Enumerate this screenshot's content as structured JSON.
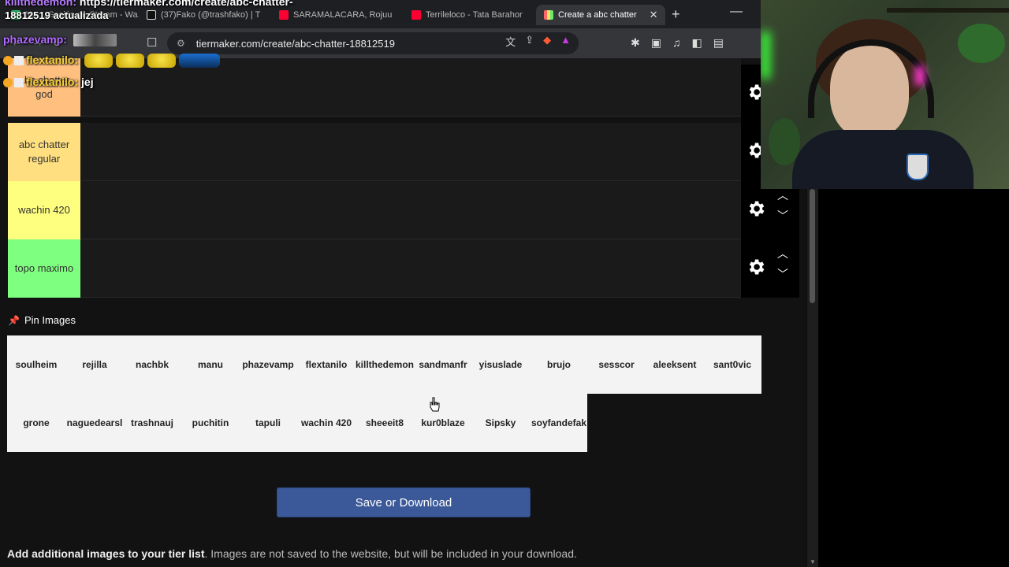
{
  "chat": [
    {
      "user": "killthedemon:",
      "text": "https://tiermaker.com/create/abc-chatter-",
      "cont": "18812519 actualizada"
    },
    {
      "user": "phazevamp:",
      "text": ""
    },
    {
      "user": "flextanilo:",
      "text": ""
    },
    {
      "user": "flextanilo:",
      "text": "jej"
    }
  ],
  "tabs": [
    {
      "label": "No ... Sesión de Stream - Wa...",
      "active": false
    },
    {
      "label": "(37)Fako (@trashfako) | T",
      "active": false
    },
    {
      "label": "SARAMALACARA, Rojuu",
      "active": false
    },
    {
      "label": "Terrileloco - Tata Barahor",
      "active": false
    },
    {
      "label": "Create a abc chatter",
      "active": true
    }
  ],
  "address": {
    "url": "tiermaker.com/create/abc-chatter-18812519"
  },
  "tiers": [
    {
      "label": "abc chatter god",
      "color": "#ffbf7f"
    },
    {
      "label": "abc chatter regular",
      "color": "#ffdf7f"
    },
    {
      "label": "wachin 420",
      "color": "#ffff7f"
    },
    {
      "label": "topo maximo",
      "color": "#7fff7f"
    }
  ],
  "pin": {
    "label": "Pin Images"
  },
  "pool": {
    "row1": [
      "soulheim",
      "rejilla",
      "nachbk",
      "manu",
      "phazevamp",
      "flextanilo",
      "killthedemon",
      "sandmanfr",
      "yisuslade",
      "brujo",
      "sesscor",
      "aleeksent",
      "sant0vic"
    ],
    "row2": [
      "grone",
      "naguedearsl",
      "trashnauj",
      "puchitin",
      "tapuli",
      "wachin 420",
      "sheeeit8",
      "kur0blaze",
      "Sipsky",
      "soyfandefak"
    ]
  },
  "save_button": {
    "label": "Save or Download"
  },
  "footer": {
    "bold": "Add additional images to your tier list",
    "rest": ". Images are not saved to the website, but will be included in your download."
  },
  "icons": {
    "reload": "reload-icon",
    "bookmark": "bookmark-icon",
    "tune": "site-info-icon",
    "translate": "translate-icon",
    "share": "share-icon",
    "brave": "brave-shields-icon",
    "rewards": "brave-rewards-icon",
    "extensions": "extensions-icon",
    "gear": "gear-icon"
  }
}
